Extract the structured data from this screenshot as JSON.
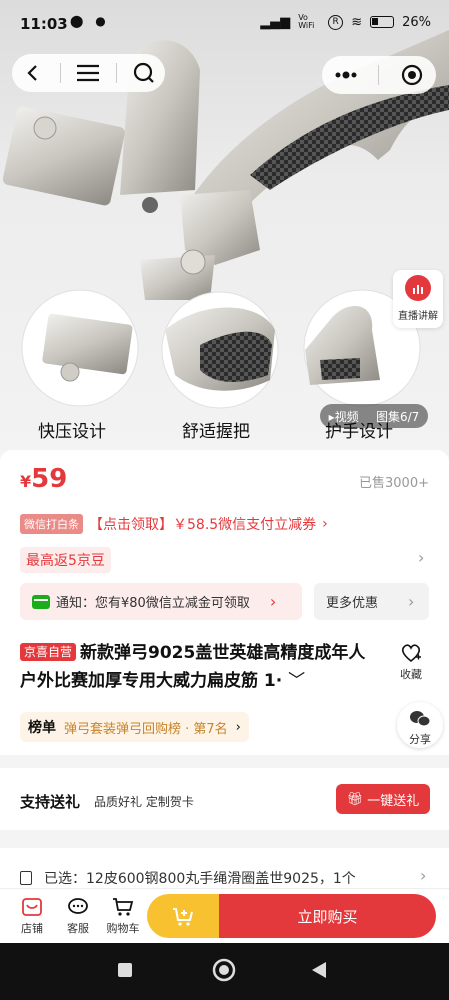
{
  "status": {
    "time": "11:03",
    "battery": "26%",
    "left_icons": "⬤ ●",
    "vowifi": "Vo WiFi",
    "circle_r": "R"
  },
  "hero": {
    "features": [
      "快压设计",
      "舒适握把",
      "护手设计"
    ],
    "video_label": "▸视频",
    "gallery_label": "图集6/7",
    "live_label": "直播讲解"
  },
  "price": {
    "symbol": "¥",
    "value": "59",
    "sold": "已售3000+"
  },
  "promos": {
    "wechat_tag": "微信打白条",
    "coupon_text": "【点击领取】￥58.5微信支付立减券",
    "beans": "最高返5京豆",
    "notice": "通知：您有¥80微信立减金可领取",
    "more": "更多优惠"
  },
  "product": {
    "tag": "京喜自营",
    "title": "新款弹弓9025盖世英雄高精度成年人户外比赛加厚专用大威力扁皮筋 1·",
    "fav": "收藏",
    "share": "分享"
  },
  "rank": {
    "label": "榜单",
    "text": "弹弓套装弹弓回购榜 · 第7名"
  },
  "gift": {
    "title": "支持送礼",
    "sub": "品质好礼 定制贺卡",
    "button": "一键送礼"
  },
  "selected": {
    "text": "已选：12皮600钢800丸手绳滑圈盖世9025，1个"
  },
  "bottom": {
    "shop": "店铺",
    "service": "客服",
    "cart": "购物车",
    "buy": "立即购买"
  },
  "colors": {
    "accent": "#e4393c",
    "cart": "#f7c130"
  }
}
